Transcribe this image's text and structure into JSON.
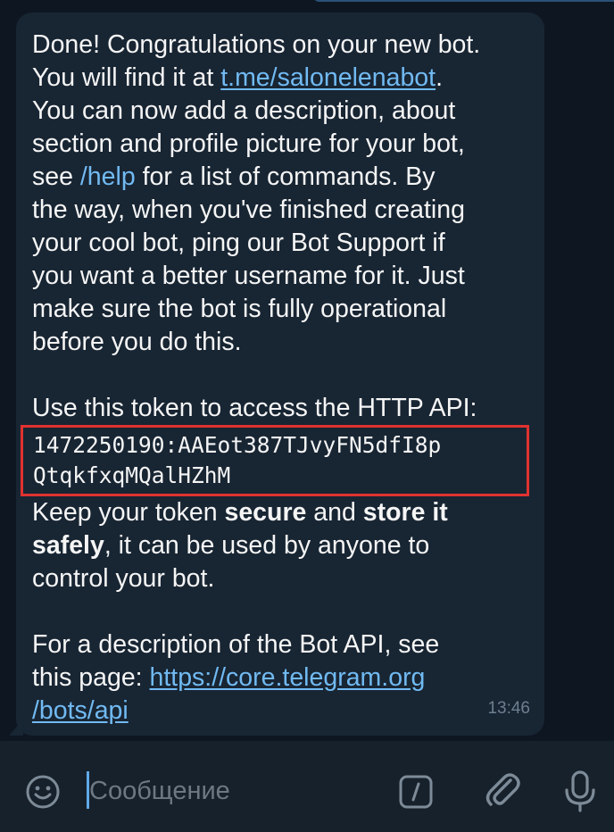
{
  "message": {
    "lines_intro": [
      "Done! Congratulations on your new bot.",
      "You will find it at ",
      "You can now add a description, about",
      "section and profile picture for your bot,",
      "see ",
      "the way, when you've finished creating",
      "your cool bot, ping our Bot Support if",
      "you want a better username for it. Just",
      "make sure the bot is fully operational",
      "before you do this."
    ],
    "bot_link": "t.me/salonelenabot",
    "bot_link_suffix": ".",
    "help_command": "/help",
    "help_suffix": " for a list of commands. By",
    "token_intro": "Use this token to access the HTTP API:",
    "token_line1": "1472250190:AAEot387TJvyFN5dfI8p",
    "token_line2": "QtqkfxqMQalHZhM",
    "keep_prefix": "Keep your token ",
    "keep_bold1": "secure",
    "keep_middle": " and ",
    "keep_bold2": "store it",
    "keep_line2_bold": "safely",
    "keep_line2_rest": ", it can be used by anyone to",
    "keep_line3": "control your bot.",
    "api_line1": "For a description of the Bot API, see",
    "api_line2_prefix": "this page: ",
    "api_url_part1": "https://core.telegram.org",
    "api_url_part2": "/bots/api",
    "time": "13:46"
  },
  "composer": {
    "placeholder": "Сообщение"
  },
  "icons": {
    "emoji": "emoji-icon",
    "bot_commands": "slash-command-icon",
    "attach": "paperclip-icon",
    "mic": "microphone-icon"
  },
  "colors": {
    "background": "#0e1621",
    "bubble": "#182533",
    "link": "#71baf2",
    "highlight_box": "#e0322f",
    "composer": "#17212b"
  }
}
